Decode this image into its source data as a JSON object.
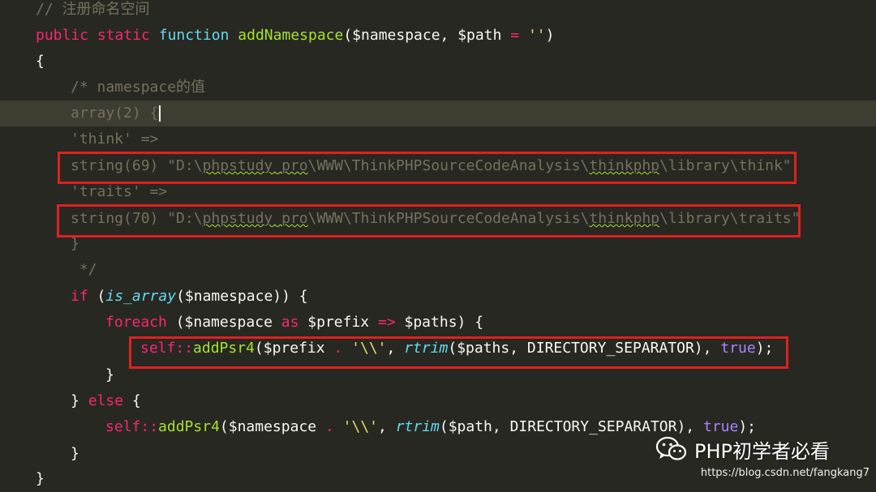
{
  "code": {
    "l1": {
      "comment": "// 注册命名空间"
    },
    "l2": {
      "kw_public": "public",
      "kw_static": "static",
      "kw_function": "function",
      "fn_name": "addNamespace",
      "sig_a": "($namespace, $path ",
      "op_eq": "=",
      "sp": " ",
      "str_empty": "''",
      "close": ")"
    },
    "l3": {
      "text": "{"
    },
    "l4": {
      "comment": "/* namespace的值"
    },
    "l5": {
      "comment": "array(2) {"
    },
    "l6": {
      "comment": "'think' =>"
    },
    "l7": {
      "a": "string(69) \"D:\\",
      "b": "phpstudy_pro",
      "c": "\\WWW\\ThinkPHPSourceCodeAnalysis\\",
      "d": "thinkphp",
      "e": "\\library\\think\""
    },
    "l8": {
      "comment": "'traits' =>"
    },
    "l9": {
      "a": "string(70) \"D:\\",
      "b": "phpstudy_pro",
      "c": "\\WWW\\ThinkPHPSourceCodeAnalysis\\",
      "d": "thinkphp",
      "e": "\\library\\traits\""
    },
    "l10": {
      "comment": "}"
    },
    "l11": {
      "comment": " */"
    },
    "l12": {
      "kw_if": "if",
      "a": " (",
      "fn": "is_array",
      "b": "($namespace)) {"
    },
    "l13": {
      "kw_foreach": "foreach",
      "a": " ($namespace ",
      "kw_as": "as",
      "b": " $prefix ",
      "op_arrow": "=>",
      "c": " $paths) {"
    },
    "l14": {
      "self": "self",
      "op_scope": "::",
      "fn": "addPsr4",
      "a": "($prefix ",
      "op_dot": ".",
      "b": " ",
      "str": "'\\\\'",
      "c": ", ",
      "fn2": "rtrim",
      "d": "($paths, DIRECTORY_SEPARATOR), ",
      "kw_true": "true",
      "e": ");"
    },
    "l15": {
      "text": "}"
    },
    "l16": {
      "a": "} ",
      "kw_else": "else",
      "b": " {"
    },
    "l17": {
      "self": "self",
      "op_scope": "::",
      "fn": "addPsr4",
      "a": "($namespace ",
      "op_dot": ".",
      "b": " ",
      "str": "'\\\\'",
      "c": ", ",
      "fn2": "rtrim",
      "d": "($path, DIRECTORY_SEPARATOR), ",
      "kw_true": "true",
      "e": ");"
    },
    "l18": {
      "text": "}"
    },
    "l19": {
      "text": "}"
    }
  },
  "watermark": {
    "label": "PHP初学者必看",
    "url": "https://blog.csdn.net/fangkang7",
    "icon": "wechat-icon"
  },
  "colors": {
    "background": "#272822",
    "comment": "#75715e",
    "keyword": "#f92672",
    "storage": "#66d9ef",
    "function": "#a6e22e",
    "string": "#e6db74",
    "constant": "#ae81ff",
    "highlight_box": "#e02020"
  }
}
